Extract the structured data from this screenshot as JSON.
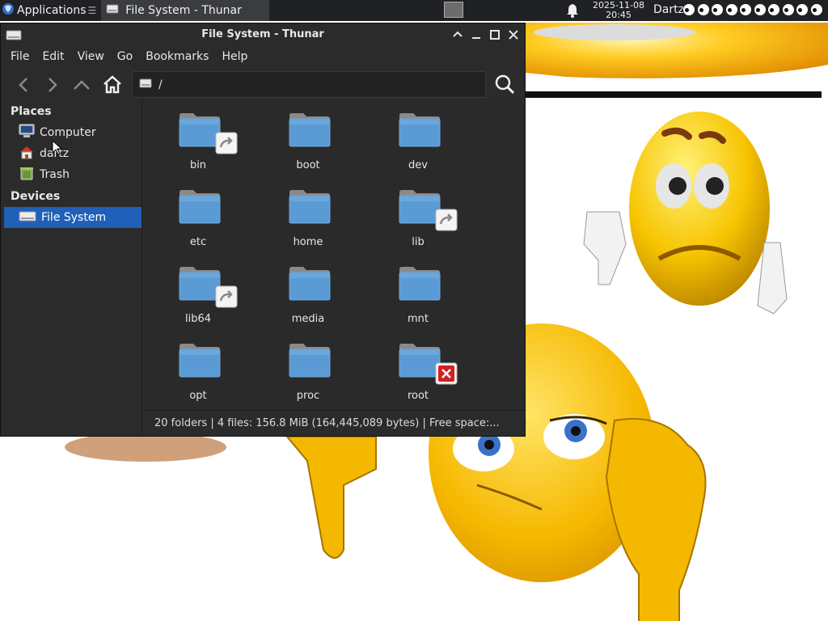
{
  "panel": {
    "applications_label": "Applications",
    "applications_suffix": "☰",
    "task_title": "File System - Thunar",
    "clock_date": "2025-11-08",
    "clock_time": "20:45",
    "user": "Dartz",
    "eyes_count": 10
  },
  "window": {
    "title": "File System - Thunar",
    "menu": [
      "File",
      "Edit",
      "View",
      "Go",
      "Bookmarks",
      "Help"
    ],
    "location_path": "/",
    "sidebar": {
      "places_heading": "Places",
      "places": [
        {
          "label": "Computer",
          "icon": "computer-icon"
        },
        {
          "label": "dartz",
          "icon": "home-icon"
        },
        {
          "label": "Trash",
          "icon": "trash-icon"
        }
      ],
      "devices_heading": "Devices",
      "devices": [
        {
          "label": "File System",
          "icon": "drive-icon",
          "selected": true
        }
      ]
    },
    "folders": [
      {
        "name": "bin",
        "emblem": "symlink"
      },
      {
        "name": "boot",
        "emblem": ""
      },
      {
        "name": "dev",
        "emblem": ""
      },
      {
        "name": "etc",
        "emblem": ""
      },
      {
        "name": "home",
        "emblem": ""
      },
      {
        "name": "lib",
        "emblem": "symlink"
      },
      {
        "name": "lib64",
        "emblem": "symlink"
      },
      {
        "name": "media",
        "emblem": ""
      },
      {
        "name": "mnt",
        "emblem": ""
      },
      {
        "name": "opt",
        "emblem": ""
      },
      {
        "name": "proc",
        "emblem": ""
      },
      {
        "name": "root",
        "emblem": "no-access"
      }
    ],
    "statusbar": "20 folders  |  4 files: 156.8 MiB (164,445,089 bytes)  |  Free space:..."
  },
  "colors": {
    "panel_bg": "#1f2124",
    "window_bg": "#2b2b2b",
    "selection": "#2060b8",
    "folder_blue": "#5b9bd5"
  }
}
